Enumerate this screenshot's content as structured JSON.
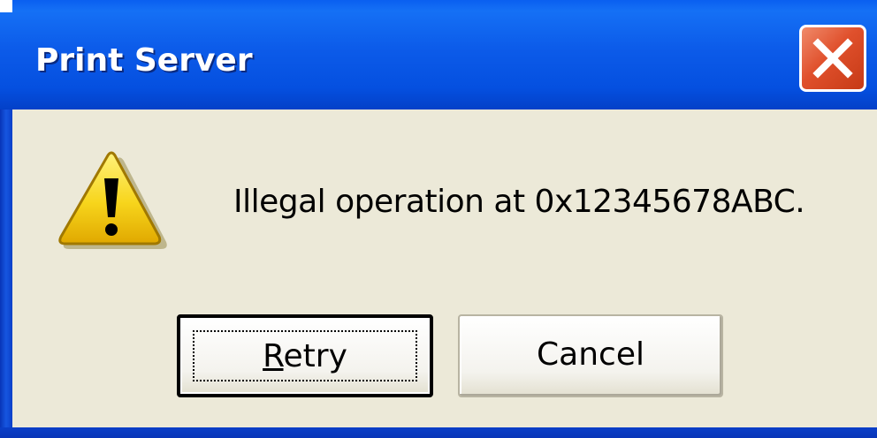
{
  "window": {
    "title": "Print Server",
    "close_icon": "close-icon"
  },
  "dialog": {
    "icon": "warning-icon",
    "message": "Illegal operation at 0x12345678ABC."
  },
  "buttons": {
    "retry": {
      "label_first": "R",
      "label_rest": "etry"
    },
    "cancel": {
      "label": "Cancel"
    }
  },
  "colors": {
    "titlebar": "#0c5be9",
    "body": "#ece9d8",
    "close_button": "#e0502c",
    "warning_yellow": "#f7d51c"
  }
}
